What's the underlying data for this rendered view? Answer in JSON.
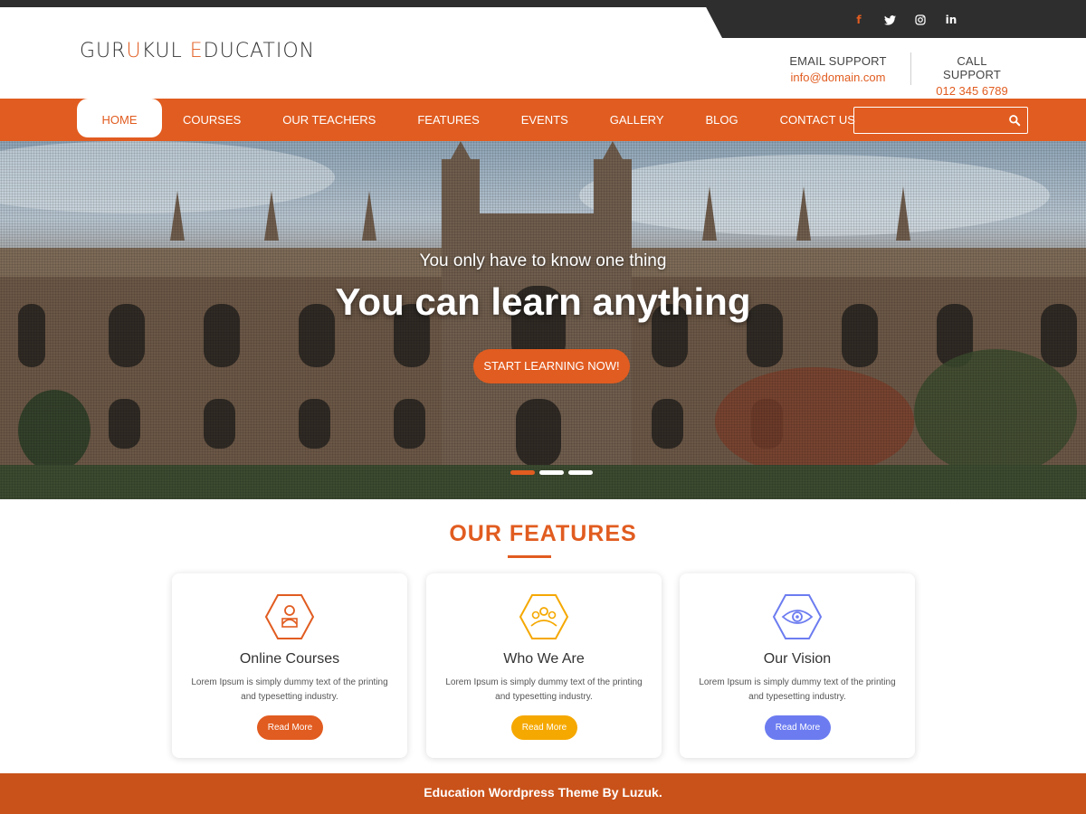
{
  "colors": {
    "accent": "#e15c20",
    "dark": "#2e2e2e",
    "footer": "#c9521a",
    "yellow": "#f5a800",
    "blue": "#6c7cf0"
  },
  "social": [
    {
      "icon": "facebook-icon",
      "glyph": "f"
    },
    {
      "icon": "twitter-icon",
      "glyph": "t"
    },
    {
      "icon": "instagram-icon",
      "glyph": "◎"
    },
    {
      "icon": "linkedin-icon",
      "glyph": "in"
    }
  ],
  "logo": {
    "part1": "GUR",
    "accent1": "U",
    "part2": "KUL ",
    "accent2": "E",
    "part3": "DUCATION"
  },
  "support": {
    "email": {
      "label": "EMAIL SUPPORT",
      "value": "info@domain.com"
    },
    "call": {
      "label": "CALL SUPPORT",
      "value": "012 345 6789"
    }
  },
  "nav": {
    "items": [
      {
        "label": "HOME",
        "active": true
      },
      {
        "label": "COURSES"
      },
      {
        "label": "OUR TEACHERS"
      },
      {
        "label": "FEATURES"
      },
      {
        "label": "EVENTS"
      },
      {
        "label": "GALLERY"
      },
      {
        "label": "BLOG"
      },
      {
        "label": "CONTACT US"
      }
    ],
    "search_placeholder": ""
  },
  "hero": {
    "subtitle": "You only have to know one thing",
    "title": "You can learn anything",
    "button": "START LEARNING NOW!",
    "slides_total": 3,
    "active_slide": 1
  },
  "features": {
    "title": "OUR FEATURES",
    "cards": [
      {
        "title": "Online Courses",
        "text": "Lorem Ipsum is simply dummy text of the printing and typesetting industry.",
        "button": "Read More",
        "icon": "online-course-icon",
        "color": "#e15c20"
      },
      {
        "title": "Who We Are",
        "text": "Lorem Ipsum is simply dummy text of the printing and typesetting industry.",
        "button": "Read More",
        "icon": "team-icon",
        "color": "#f5a800"
      },
      {
        "title": "Our Vision",
        "text": "Lorem Ipsum is simply dummy text of the printing and typesetting industry.",
        "button": "Read More",
        "icon": "eye-icon",
        "color": "#6c7cf0"
      }
    ]
  },
  "footer": {
    "text": "Education Wordpress Theme By Luzuk."
  }
}
